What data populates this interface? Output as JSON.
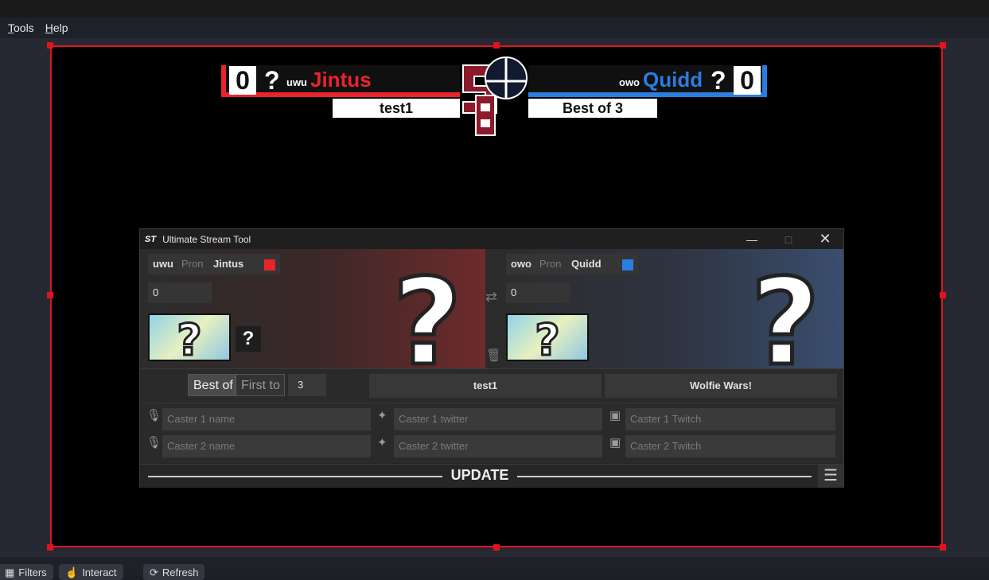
{
  "menu": {
    "tools": "Tools",
    "tools_key": "T",
    "tools_rest": "ools",
    "help_key": "H",
    "help_rest": "elp"
  },
  "bottom_buttons": {
    "filters": "Filters",
    "interact": "Interact",
    "refresh": "Refresh"
  },
  "scoreboard": {
    "p1": {
      "score": "0",
      "char": "?",
      "pronoun": "uwu",
      "name": "Jintus",
      "color": "#e8242c"
    },
    "p2": {
      "score": "0",
      "char": "?",
      "pronoun": "owo",
      "name": "Quidd",
      "color": "#2a7de1"
    },
    "round": "test1",
    "bestof": "Best of 3"
  },
  "window": {
    "app_icon": "ST",
    "title": "Ultimate Stream Tool",
    "p1": {
      "pronoun": "uwu",
      "pron_placeholder": "Pron",
      "name": "Jintus",
      "score": "0",
      "color": "#e8242c",
      "skin_char": "?"
    },
    "p2": {
      "pronoun": "owo",
      "pron_placeholder": "Pron",
      "name": "Quidd",
      "score": "0",
      "color": "#2a7de1"
    },
    "bestof_label": "Best of",
    "firstto_label": "First to",
    "bestof_value": "3",
    "round": "test1",
    "tournament": "Wolfie Wars!",
    "casters": [
      {
        "name_ph": "Caster 1 name",
        "twitter_ph": "Caster 1 twitter",
        "twitch_ph": "Caster 1 Twitch"
      },
      {
        "name_ph": "Caster 2 name",
        "twitter_ph": "Caster 2 twitter",
        "twitch_ph": "Caster 2 Twitch"
      }
    ],
    "update_label": "UPDATE"
  }
}
